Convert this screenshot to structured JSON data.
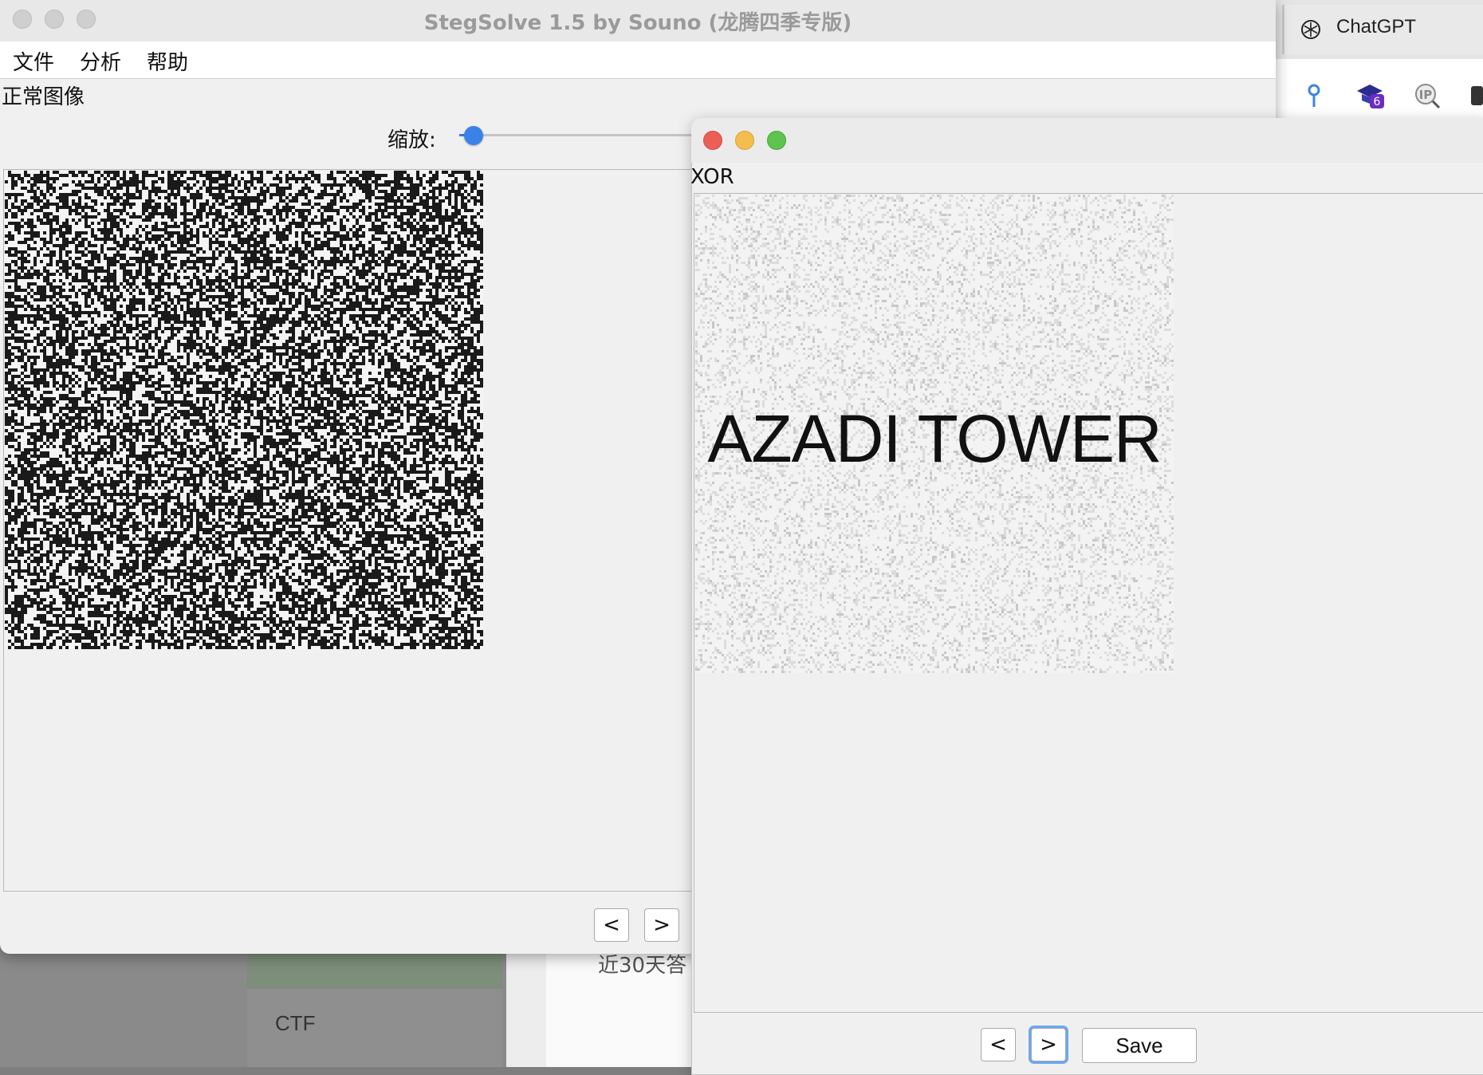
{
  "main_window": {
    "title": "StegSolve 1.5 by Souno (龙腾四季专版)",
    "menu": [
      "文件",
      "分析",
      "帮助"
    ],
    "view_label": "正常图像",
    "zoom_label": "缩放:",
    "zoom_level": 0.06,
    "prev_label": "<",
    "next_label": ">"
  },
  "xor_window": {
    "label": "XOR",
    "image_text": "AZADI TOWER",
    "prev_label": "<",
    "next_label": ">",
    "save_label": "Save"
  },
  "browser": {
    "tab_title": "ChatGPT",
    "extension_badge": "6",
    "ip_label": "IP"
  },
  "background": {
    "stat_text": "近30天答",
    "category": "CTF"
  },
  "colors": {
    "close": "#ec5f57",
    "minimize": "#f4be4f",
    "maximize": "#5fc34f",
    "slider_accent": "#3b82e6"
  }
}
